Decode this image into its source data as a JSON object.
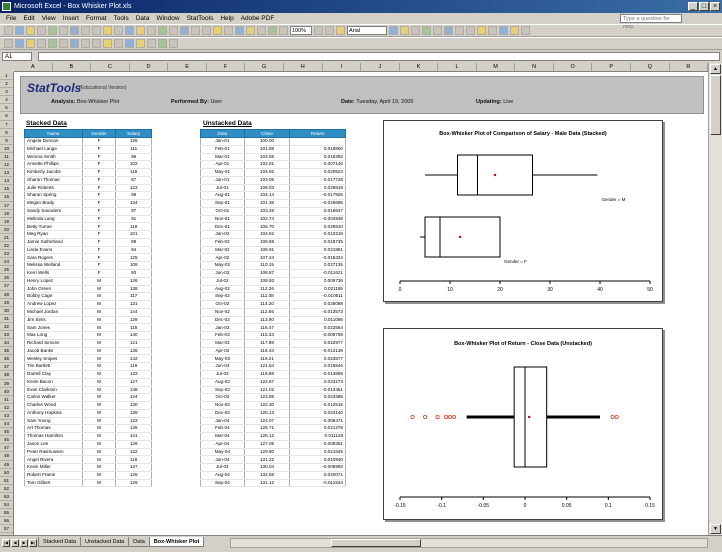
{
  "window": {
    "title": "Microsoft Excel - Box Whisker Plot.xls",
    "buttons": [
      "_",
      "□",
      "×"
    ]
  },
  "menu": [
    "File",
    "Edit",
    "View",
    "Insert",
    "Format",
    "Tools",
    "Data",
    "Window",
    "StatTools",
    "Help",
    "Adobe PDF"
  ],
  "help_placeholder": "Type a question for help",
  "toolbar": {
    "zoom": "100%",
    "font": "Arial",
    "font_size": "8"
  },
  "name_box": "A1",
  "column_headers": [
    "A",
    "B",
    "C",
    "D",
    "E",
    "F",
    "G",
    "H",
    "I",
    "J",
    "K",
    "L",
    "M",
    "N",
    "O",
    "P",
    "Q",
    "R"
  ],
  "report": {
    "logo": "StatTools",
    "logo_sub": "(Educational Version)",
    "analysis_label": "Analysis:",
    "analysis_value": "Box-Whisker Plot",
    "performed_label": "Performed By:",
    "performed_value": "User",
    "date_label": "Date:",
    "date_value": "Tuesday, April 19, 2005",
    "updating_label": "Updating:",
    "updating_value": "Live"
  },
  "stacked": {
    "label": "Stacked Data",
    "columns": [
      "Name",
      "Gender",
      "Salary"
    ],
    "rows": [
      [
        "Angela Duncan",
        "F",
        "128"
      ],
      [
        "Michael Lange",
        "F",
        "111"
      ],
      [
        "Winona Smith",
        "F",
        "96"
      ],
      [
        "Annette Phillips",
        "F",
        "102"
      ],
      [
        "Kimberly Jacobs",
        "F",
        "115"
      ],
      [
        "Sharon Thomas",
        "F",
        "87"
      ],
      [
        "Julie Roberts",
        "F",
        "123"
      ],
      [
        "Sharon Spring",
        "F",
        "98"
      ],
      [
        "Megan Brady",
        "F",
        "134"
      ],
      [
        "Sandy Saunders",
        "F",
        "97"
      ],
      [
        "Melinda Lang",
        "F",
        "91"
      ],
      [
        "Betty Turner",
        "F",
        "119"
      ],
      [
        "Meg Ryan",
        "F",
        "101"
      ],
      [
        "Jamie Sutherland",
        "F",
        "88"
      ],
      [
        "Linda Evans",
        "F",
        "94"
      ],
      [
        "Sara Rogers",
        "F",
        "125"
      ],
      [
        "Melissa Welland",
        "F",
        "109"
      ],
      [
        "Kerri Wells",
        "F",
        "93"
      ],
      [
        "Henry Lopez",
        "M",
        "126"
      ],
      [
        "John Green",
        "M",
        "138"
      ],
      [
        "Bobby Cage",
        "M",
        "117"
      ],
      [
        "Andrew Lopez",
        "M",
        "131"
      ],
      [
        "Michael Jordan",
        "M",
        "144"
      ],
      [
        "Jim Sims",
        "M",
        "129"
      ],
      [
        "Sam Jones",
        "M",
        "115"
      ],
      [
        "Max Long",
        "M",
        "140"
      ],
      [
        "Richard Simons",
        "M",
        "121"
      ],
      [
        "Jacob Banks",
        "M",
        "136"
      ],
      [
        "Wesley Snipes",
        "M",
        "142"
      ],
      [
        "Tim Bartlett",
        "M",
        "119"
      ],
      [
        "Darrell Clay",
        "M",
        "133"
      ],
      [
        "Kevin Bacon",
        "M",
        "127"
      ],
      [
        "Evan Clarkson",
        "M",
        "148"
      ],
      [
        "Carlos Walker",
        "M",
        "124"
      ],
      [
        "Charles Wood",
        "M",
        "130"
      ],
      [
        "Anthony Hopkins",
        "M",
        "139"
      ],
      [
        "Sam Young",
        "M",
        "122"
      ],
      [
        "Art Thomas",
        "M",
        "135"
      ],
      [
        "Thomas Hamilton",
        "M",
        "141"
      ],
      [
        "Jason Lee",
        "M",
        "128"
      ],
      [
        "Peter Rasmussen",
        "M",
        "132"
      ],
      [
        "Angel Rivera",
        "M",
        "118"
      ],
      [
        "Kevin Miller",
        "M",
        "137"
      ],
      [
        "Robert Frame",
        "M",
        "125"
      ],
      [
        "Tom Gilbert",
        "M",
        "129"
      ]
    ]
  },
  "unstacked": {
    "label": "Unstacked Data",
    "columns": [
      "Date",
      "Close",
      "Return"
    ],
    "rows": [
      [
        "Jan-01",
        "100.00",
        ""
      ],
      [
        "Feb-01",
        "101.88",
        "0.018800"
      ],
      [
        "Mar-01",
        "103.55",
        "0.016392"
      ],
      [
        "Apr-01",
        "102.81",
        "-0.007146"
      ],
      [
        "May-01",
        "104.92",
        "0.020523"
      ],
      [
        "Jun-01",
        "103.06",
        "-0.017728"
      ],
      [
        "Jul-01",
        "106.03",
        "0.028819"
      ],
      [
        "Aug-01",
        "104.14",
        "-0.017825"
      ],
      [
        "Sep-01",
        "101.36",
        "-0.026695"
      ],
      [
        "Oct-01",
        "103.25",
        "0.018647"
      ],
      [
        "Nov-01",
        "102.74",
        "-0.004939"
      ],
      [
        "Dec-01",
        "105.70",
        "0.028810"
      ],
      [
        "Jan-02",
        "104.62",
        "-0.010218"
      ],
      [
        "Feb-02",
        "106.58",
        "0.018735"
      ],
      [
        "Mar-02",
        "108.91",
        "0.021861"
      ],
      [
        "Apr-02",
        "107.24",
        "-0.015334"
      ],
      [
        "May-02",
        "110.15",
        "0.027135"
      ],
      [
        "Jun-02",
        "108.87",
        "-0.011621"
      ],
      [
        "Jul-02",
        "109.93",
        "0.009736"
      ],
      [
        "Aug-02",
        "112.26",
        "0.021195"
      ],
      [
        "Sep-02",
        "111.08",
        "-0.010511"
      ],
      [
        "Oct-02",
        "114.20",
        "0.028088"
      ],
      [
        "Nov-02",
        "112.65",
        "-0.013573"
      ],
      [
        "Dec-02",
        "113.90",
        "0.011096"
      ],
      [
        "Jan-03",
        "116.47",
        "0.022564"
      ],
      [
        "Feb-03",
        "115.33",
        "-0.009788"
      ],
      [
        "Mar-03",
        "117.98",
        "0.022977"
      ],
      [
        "Apr-03",
        "116.43",
        "-0.013138"
      ],
      [
        "May-03",
        "119.21",
        "0.023877"
      ],
      [
        "Jun-03",
        "121.54",
        "0.019546"
      ],
      [
        "Jul-03",
        "119.88",
        "-0.013658"
      ],
      [
        "Aug-03",
        "122.67",
        "0.023273"
      ],
      [
        "Sep-03",
        "121.02",
        "-0.013451"
      ],
      [
        "Oct-03",
        "123.85",
        "0.023385"
      ],
      [
        "Nov-03",
        "122.30",
        "-0.012515"
      ],
      [
        "Dec-03",
        "125.13",
        "0.023140"
      ],
      [
        "Jan-04",
        "124.07",
        "-0.008471"
      ],
      [
        "Feb-04",
        "126.71",
        "0.021278"
      ],
      [
        "Mar-04",
        "128.12",
        "0.011128"
      ],
      [
        "Apr-04",
        "127.05",
        "-0.008351"
      ],
      [
        "May-04",
        "129.80",
        "0.021645"
      ],
      [
        "Jun-04",
        "131.22",
        "0.010940"
      ],
      [
        "Jul-04",
        "130.04",
        "-0.008993"
      ],
      [
        "Aug-04",
        "132.65",
        "0.020071"
      ],
      [
        "Sep-04",
        "131.12",
        "-0.011534"
      ]
    ]
  },
  "chart_data": [
    {
      "type": "boxplot",
      "title": "Box-Whisker Plot of Comparison of Salary - Male Data (Stacked)",
      "orientation": "horizontal",
      "xlim": [
        0,
        50
      ],
      "ticks": [
        0,
        10,
        20,
        30,
        40,
        50
      ],
      "series": [
        {
          "name": "Gender = M",
          "min": 5,
          "q1": 11.5,
          "median": 15.5,
          "mean": 19,
          "q3": 26.5,
          "max": 39.5
        },
        {
          "name": "Gender = F",
          "min": 4,
          "q1": 5,
          "median": 8,
          "mean": 12,
          "q3": 20,
          "max": 20
        }
      ]
    },
    {
      "type": "boxplot",
      "title": "Box-Whisker Plot of Return - Close Data (Unstacked)",
      "orientation": "vertical-box",
      "xlim": [
        -0.15,
        0.15
      ],
      "ticks": [
        -0.15,
        -0.1,
        -0.05,
        0,
        0.05,
        0.1,
        0.15
      ],
      "series": [
        {
          "name": "Return",
          "min": -0.07,
          "q1": -0.013,
          "median": 0.0,
          "mean": 0.005,
          "q3": 0.026,
          "max": 0.09,
          "outliers": [
            -0.135,
            -0.12,
            -0.105,
            -0.095,
            -0.09,
            -0.085,
            0.105,
            0.11
          ]
        }
      ]
    }
  ],
  "sheet_tabs": [
    "Stacked Data",
    "Unstacked Data",
    "Data",
    "Box-Whisker Plot"
  ],
  "active_tab": "Box-Whisker Plot"
}
